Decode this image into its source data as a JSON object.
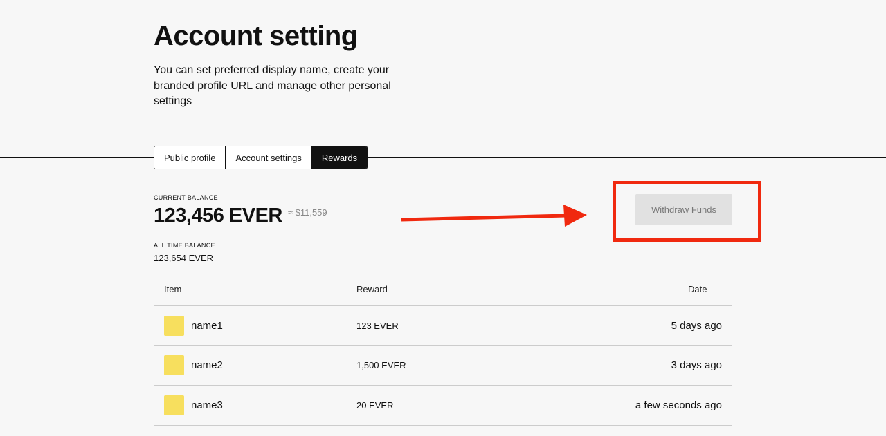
{
  "header": {
    "title": "Account setting",
    "subtitle": "You can set preferred display name, create your branded profile URL and manage other personal settings"
  },
  "tabs": [
    "Public profile",
    "Account settings",
    "Rewards"
  ],
  "active_tab": "Rewards",
  "balance": {
    "current_label": "CURRENT BALANCE",
    "current_value": "123,456 EVER",
    "current_usd": "≈ $11,559",
    "all_time_label": "ALL TIME BALANCE",
    "all_time_value": "123,654 EVER"
  },
  "withdraw_label": "Withdraw Funds",
  "table": {
    "headers": {
      "item": "Item",
      "reward": "Reward",
      "date": "Date"
    },
    "rows": [
      {
        "name": "name1",
        "reward": "123 EVER",
        "date": "5 days ago"
      },
      {
        "name": "name2",
        "reward": "1,500 EVER",
        "date": "3 days ago"
      },
      {
        "name": "name3",
        "reward": "20 EVER",
        "date": "a few seconds ago"
      }
    ]
  },
  "colors": {
    "annotation_red": "#f0290f",
    "thumbnail_yellow": "#f7df5e",
    "tab_active_bg": "#111111"
  }
}
